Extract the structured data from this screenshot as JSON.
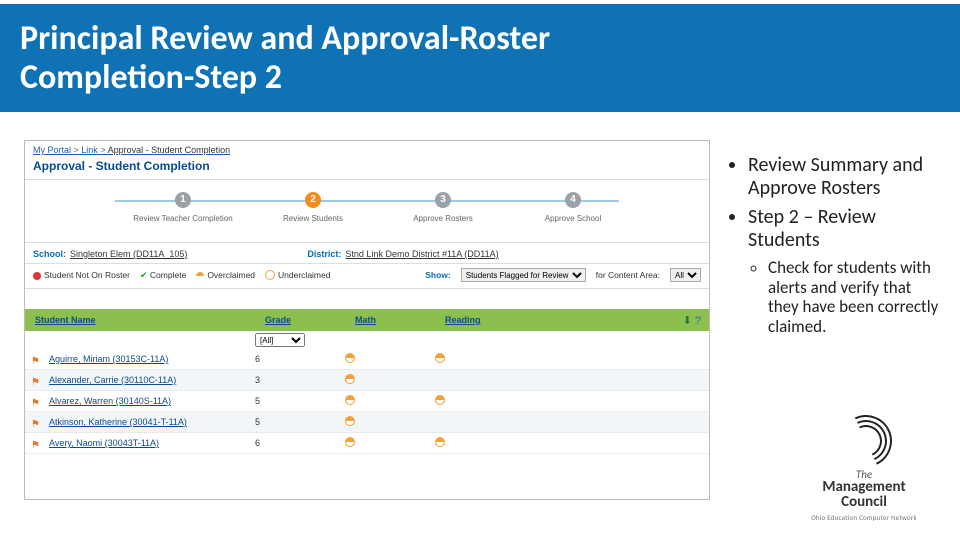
{
  "title_line1": "Principal Review and Approval-Roster",
  "title_line2": "Completion-Step 2",
  "bullets": {
    "b1": "Review Summary and Approve Rosters",
    "b2": "Step 2 – Review Students",
    "b2a": "Check for students with alerts and verify that they have been correctly claimed."
  },
  "screenshot": {
    "crumbs": {
      "a": "My Portal",
      "b": "Link",
      "c": "Approval - Student Completion"
    },
    "page_title": "Approval - Student Completion",
    "steps": {
      "s1": {
        "n": "1",
        "label": "Review Teacher Completion"
      },
      "s2": {
        "n": "2",
        "label": "Review Students"
      },
      "s3": {
        "n": "3",
        "label": "Approve Rosters"
      },
      "s4": {
        "n": "4",
        "label": "Approve School"
      }
    },
    "school": {
      "school_lbl": "School:",
      "school_val": "Singleton Elem (DD11A_105)",
      "district_lbl": "District:",
      "district_val": "Stnd Link Demo District #11A (DD11A)"
    },
    "legend": {
      "notroster": "Student Not On Roster",
      "complete": "Complete",
      "overclaimed": "Overclaimed",
      "underclaimed": "Underclaimed",
      "show_lbl": "Show:",
      "show_val": "Students Flagged for Review",
      "area_lbl": "for Content Area:",
      "area_val": "All"
    },
    "table": {
      "headers": {
        "name": "Student Name",
        "grade": "Grade",
        "math": "Math",
        "reading": "Reading"
      },
      "grade_filter": "[All]",
      "rows": [
        {
          "name": "Aguirre, Miriam (30153C-11A)",
          "grade": "6",
          "flag_color": "#e57a2b"
        },
        {
          "name": "Alexander, Carrie (30110C-11A)",
          "grade": "3",
          "flag_color": "#e57a2b"
        },
        {
          "name": "Alvarez, Warren (30140S-11A)",
          "grade": "5",
          "flag_color": "#e57a2b"
        },
        {
          "name": "Atkinson, Katherine (30041-T-11A)",
          "grade": "5",
          "flag_color": "#e57a2b"
        },
        {
          "name": "Avery, Naomi (30043T-11A)",
          "grade": "6",
          "flag_color": "#e57a2b"
        }
      ]
    }
  },
  "logo": {
    "the": "The",
    "mgmt": "Management",
    "council": "Council",
    "sub": "Ohio Education Computer Network"
  }
}
